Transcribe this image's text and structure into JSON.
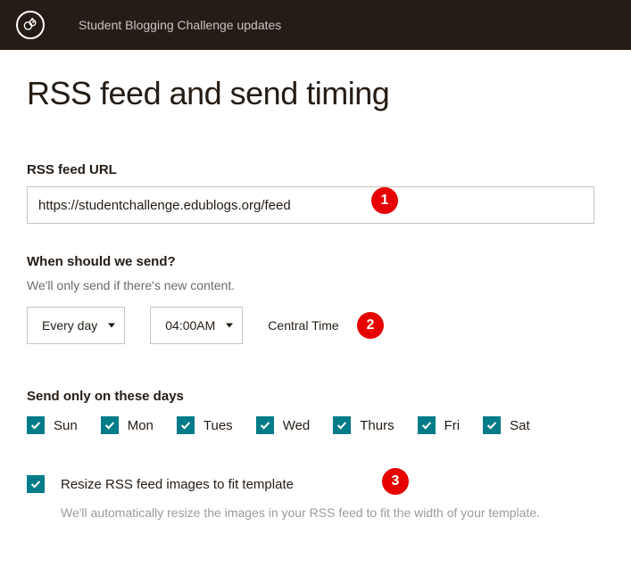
{
  "topbar": {
    "title": "Student Blogging Challenge updates"
  },
  "page": {
    "title": "RSS feed and send timing"
  },
  "rss": {
    "label": "RSS feed URL",
    "value": "https://studentchallenge.edublogs.org/feed"
  },
  "when": {
    "label": "When should we send?",
    "helper": "We'll only send if there's new content.",
    "frequency": "Every day",
    "time": "04:00AM",
    "timezone": "Central Time"
  },
  "days": {
    "label": "Send only on these days",
    "items": [
      {
        "label": "Sun",
        "checked": true
      },
      {
        "label": "Mon",
        "checked": true
      },
      {
        "label": "Tues",
        "checked": true
      },
      {
        "label": "Wed",
        "checked": true
      },
      {
        "label": "Thurs",
        "checked": true
      },
      {
        "label": "Fri",
        "checked": true
      },
      {
        "label": "Sat",
        "checked": true
      }
    ]
  },
  "resize": {
    "checked": true,
    "label": "Resize RSS feed images to fit template",
    "helper": "We'll automatically resize the images in your RSS feed to fit the width of your template."
  },
  "badges": {
    "b1": "1",
    "b2": "2",
    "b3": "3"
  }
}
